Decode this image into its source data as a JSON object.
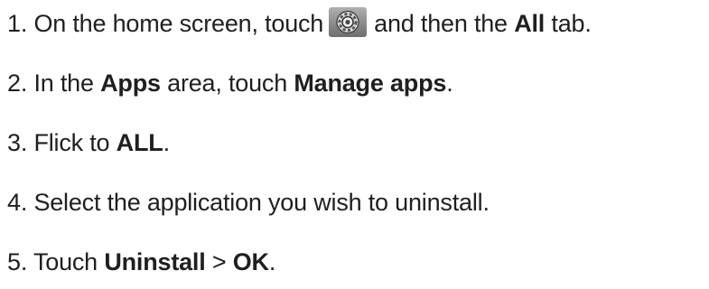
{
  "steps": [
    {
      "number": "1.",
      "text_before_icon": "On the home screen, touch",
      "icon": "settings-gear-icon",
      "text_after_icon": "and then the",
      "bold": "All",
      "text_end": "tab."
    },
    {
      "number": "2.",
      "text1": "In the",
      "bold1": "Apps",
      "text2": "area, touch",
      "bold2": "Manage apps",
      "text3": "."
    },
    {
      "number": "3.",
      "text1": "Flick to",
      "bold1": "ALL",
      "text2": "."
    },
    {
      "number": "4.",
      "text1": "Select the application you wish to uninstall."
    },
    {
      "number": "5.",
      "text1": "Touch",
      "bold1": "Uninstall",
      "text2": ">",
      "bold2": "OK",
      "text3": "."
    }
  ]
}
